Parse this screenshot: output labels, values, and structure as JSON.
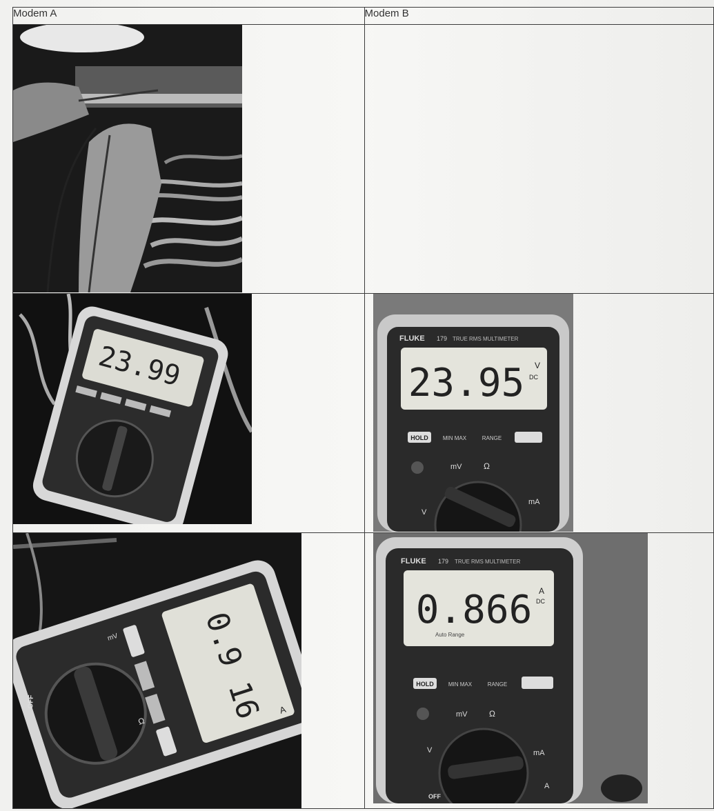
{
  "columns": {
    "a": "Modem A",
    "b": "Modem B"
  },
  "photos": {
    "a_voltage": {
      "reading": "23.99"
    },
    "b_voltage": {
      "reading": "23.95",
      "unit": "V",
      "mode": "DC",
      "brand": "FLUKE",
      "model": "179",
      "subtitle": "TRUE RMS MULTIMETER"
    },
    "a_current": {
      "reading": "0.9 16",
      "unit": "A"
    },
    "b_current": {
      "reading": "0.866",
      "unit": "A",
      "mode": "DC",
      "brand": "FLUKE",
      "model": "179",
      "subtitle": "TRUE RMS MULTIMETER",
      "range": "Auto Range"
    }
  },
  "buttons": {
    "hold": "HOLD",
    "minmax": "MIN MAX",
    "range": "RANGE",
    "off": "OFF"
  },
  "dial": {
    "mv": "mV",
    "ohm": "Ω",
    "ma": "mA",
    "a": "A",
    "v": "V"
  }
}
